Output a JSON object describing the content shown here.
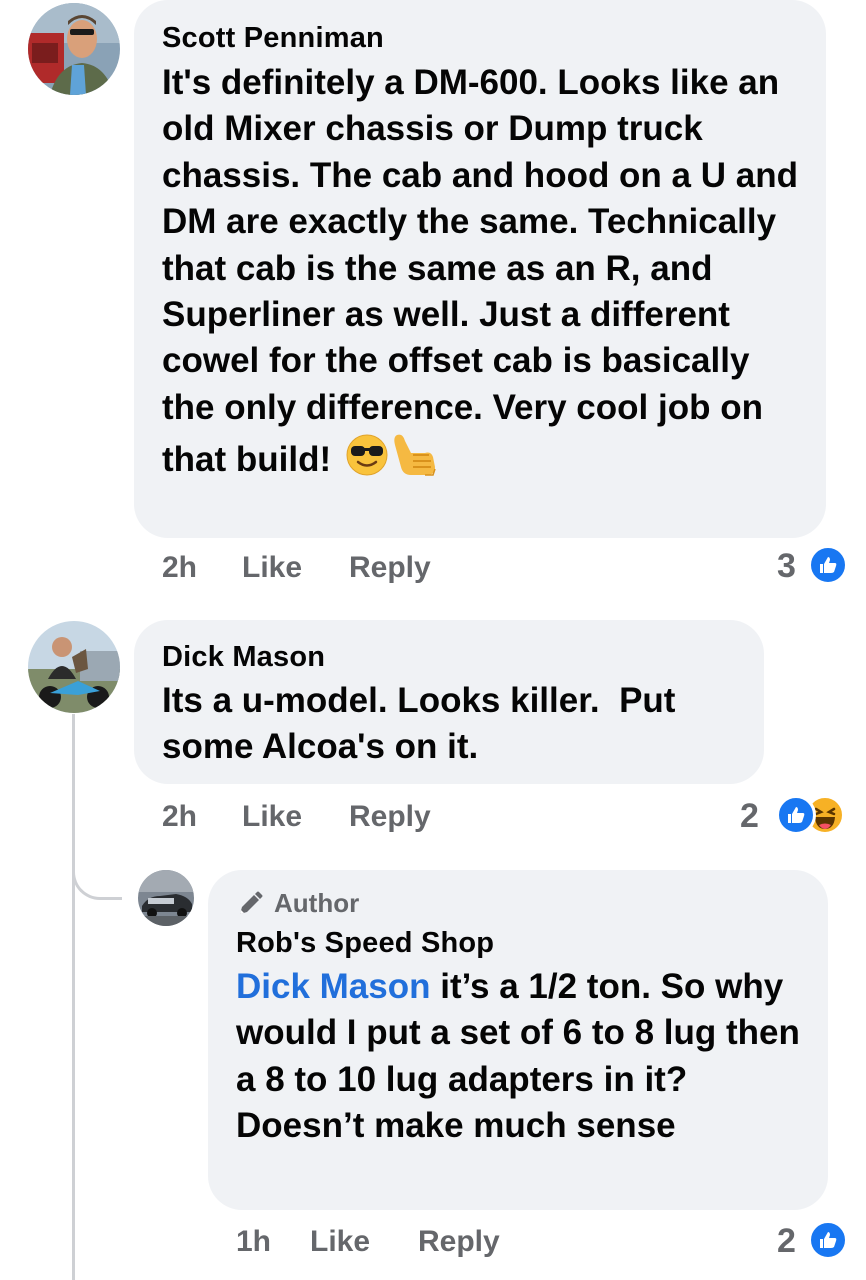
{
  "comments": [
    {
      "author": "Scott Penniman",
      "text": "It's definitely a DM-600. Looks like an old Mixer chassis or Dump truck chassis. The cab and hood on a U and DM are exactly the same. Technically that cab is the same as an R, and Superliner as well. Just a different cowel for the offset cab is basically the only difference. Very cool job on that build!",
      "time": "2h",
      "like_label": "Like",
      "reply_label": "Reply",
      "reaction_count": "3"
    },
    {
      "author": "Dick Mason",
      "text": "Its a u-model. Looks killer.  Put some Alcoa's on it.",
      "time": "2h",
      "like_label": "Like",
      "reply_label": "Reply",
      "reaction_count": "2"
    }
  ],
  "reply": {
    "badge": "Author",
    "author": "Rob's Speed Shop",
    "mention": "Dick Mason",
    "text": " it’s a 1/2 ton. So why would I put a set of 6 to 8 lug then a 8 to 10 lug adapters in it? Doesn’t make much sense",
    "time": "1h",
    "like_label": "Like",
    "reply_label": "Reply",
    "reaction_count": "2"
  },
  "icons": {
    "sunglasses_emoji": "sunglasses-emoji",
    "call_me_hand_emoji": "call-me-hand-emoji",
    "like_reaction": "like-icon",
    "haha_reaction": "haha-icon",
    "author_badge": "pencil-icon"
  },
  "colors": {
    "bubble": "#f0f2f5",
    "meta_text": "#65676b",
    "like_blue": "#1877f2",
    "mention_blue": "#216fdb",
    "haha_yellow": "#f7b125"
  }
}
